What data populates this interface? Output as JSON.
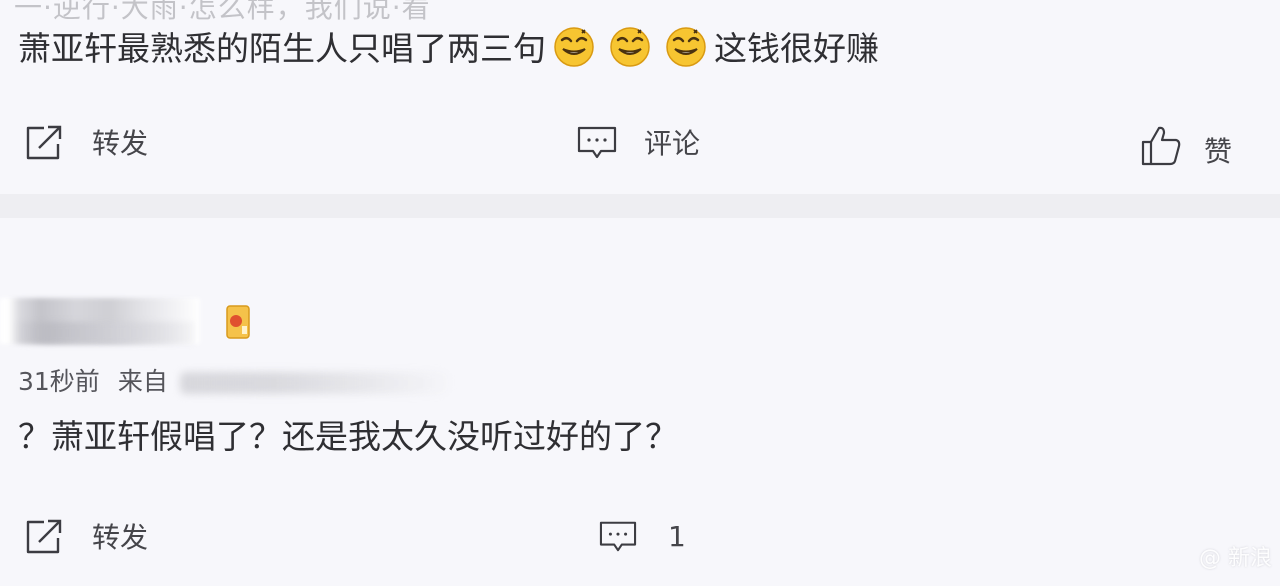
{
  "feed": {
    "top_fragment": "一·逆行·大雨·怎么样，我们说·看",
    "comments": [
      {
        "text_before": "萧亚轩最熟悉的陌生人只唱了两三句",
        "emojis": [
          "grin-emoji",
          "grin-emoji",
          "grin-emoji"
        ],
        "text_after": "这钱很好赚",
        "actions": {
          "repost_label": "转发",
          "comment_label": "评论",
          "like_label": "赞"
        }
      },
      {
        "time": "31秒前",
        "source": "来自",
        "text": "？萧亚轩假唱了？还是我太久没听过好的了？",
        "actions": {
          "repost_label": "转发",
          "comment_count": "1"
        }
      }
    ]
  },
  "watermark": "@ 新浪",
  "colors": {
    "background": "#f7f7fb",
    "divider": "#eeeef2",
    "text": "#2f2f33",
    "emoji_face": "#f7c531"
  }
}
